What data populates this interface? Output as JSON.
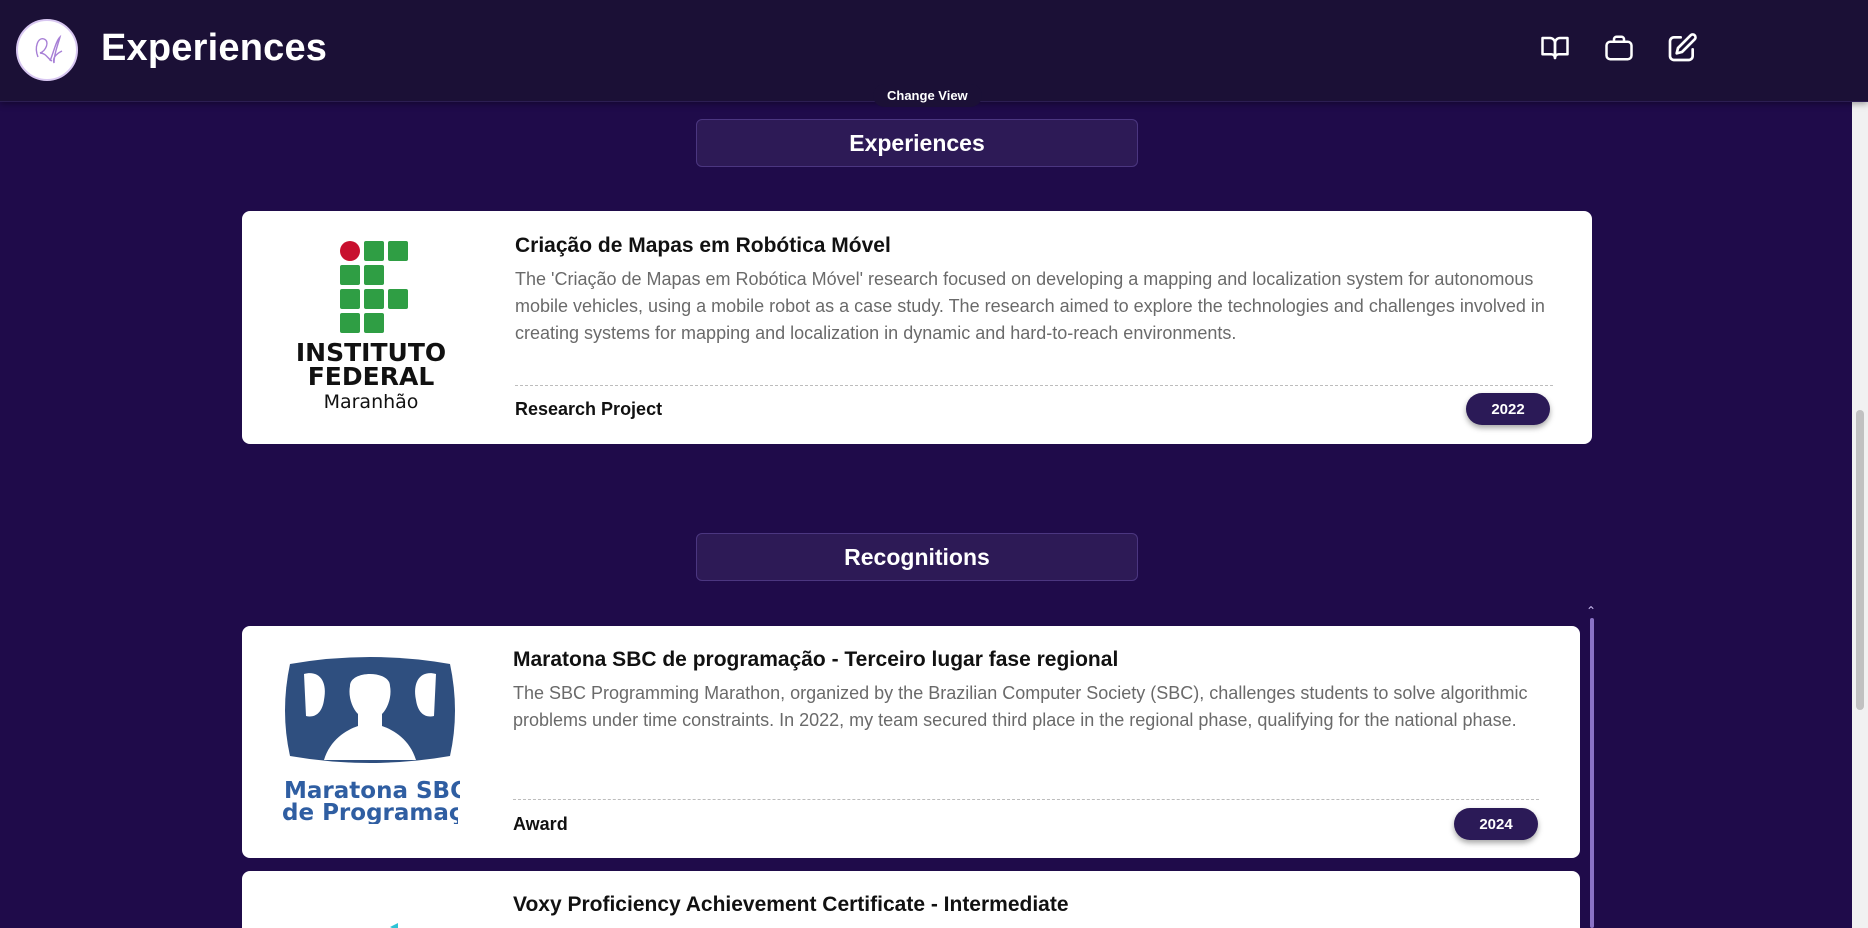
{
  "header": {
    "title": "Experiences",
    "logo_text": "Rf",
    "icons": [
      "book-open-icon",
      "briefcase-icon",
      "edit-icon"
    ]
  },
  "change_view_label": "Change View",
  "sections": {
    "experiences_title": "Experiences",
    "recognitions_title": "Recognitions"
  },
  "experiences": [
    {
      "title": "Criação de Mapas em Robótica Móvel",
      "description": "The 'Criação de Mapas em Robótica Móvel' research focused on developing a mapping and localization system for autonomous mobile vehicles, using a mobile robot as a case study. The research aimed to explore the technologies and challenges involved in creating systems for mapping and localization in dynamic and hard-to-reach environments.",
      "type": "Research Project",
      "year": "2022",
      "logo": {
        "line1": "INSTITUTO",
        "line2": "FEDERAL",
        "line3": "Maranhão"
      }
    }
  ],
  "recognitions": [
    {
      "title": "Maratona SBC de programação - Terceiro lugar fase regional",
      "description": "The SBC Programming Marathon, organized by the Brazilian Computer Society (SBC), challenges students to solve algorithmic problems under time constraints. In 2022, my team secured third place in the regional phase, qualifying for the national phase.",
      "type": "Award",
      "year": "2024",
      "logo": {
        "line1": "Maratona SBC",
        "line2": "de Programação"
      }
    },
    {
      "title": "Voxy Proficiency Achievement Certificate - Intermediate"
    }
  ],
  "colors": {
    "background": "#1f0b4a",
    "topbar": "#1b1036",
    "badge": "#2b1a57",
    "if_green": "#2f9e44",
    "if_red": "#c8102e",
    "sbc_blue": "#2f4f7f"
  }
}
